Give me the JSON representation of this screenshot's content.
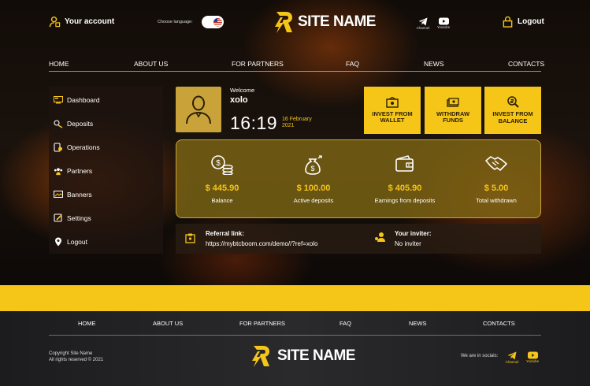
{
  "header": {
    "account_label": "Your account",
    "language_label": "Choose language:",
    "logo_text": "SITE NAME",
    "socials": [
      {
        "icon": "telegram-icon",
        "label": "Channel"
      },
      {
        "icon": "youtube-icon",
        "label": "Youtube"
      }
    ],
    "logout_label": "Logout"
  },
  "nav": [
    "HOME",
    "ABOUT US",
    "FOR PARTNERS",
    "FAQ",
    "NEWS",
    "CONTACTS"
  ],
  "sidebar": {
    "items": [
      {
        "label": "Dashboard",
        "icon": "dashboard-icon"
      },
      {
        "label": "Deposits",
        "icon": "deposits-icon"
      },
      {
        "label": "Operations",
        "icon": "operations-icon"
      },
      {
        "label": "Partners",
        "icon": "partners-icon"
      },
      {
        "label": "Banners",
        "icon": "banners-icon"
      },
      {
        "label": "Settings",
        "icon": "settings-icon"
      },
      {
        "label": "Logout",
        "icon": "logout-pin-icon"
      }
    ]
  },
  "welcome": {
    "label": "Welcome",
    "username": "xolo",
    "time": "16:19",
    "date_line1": "16 February",
    "date_line2": "2021"
  },
  "actions": [
    {
      "line1": "INVEST FROM",
      "line2": "WALLET",
      "icon": "wallet-invest-icon"
    },
    {
      "line1": "WITHDRAW",
      "line2": "FUNDS",
      "icon": "cash-icon"
    },
    {
      "line1": "INVEST FROM",
      "line2": "BALANCE",
      "icon": "balance-search-icon"
    }
  ],
  "stats": [
    {
      "value": "$ 445.90",
      "label": "Balance",
      "icon": "coins-icon"
    },
    {
      "value": "$ 100.00",
      "label": "Active deposits",
      "icon": "money-bag-icon"
    },
    {
      "value": "$ 405.90",
      "label": "Earnings from deposits",
      "icon": "wallet-icon"
    },
    {
      "value": "$ 5.00",
      "label": "Total withdrawn",
      "icon": "handshake-icon"
    }
  ],
  "referral": {
    "title": "Referral link:",
    "link": "https://mybtcboom.com/demo//?ref=xolo",
    "inviter_title": "Your inviter:",
    "inviter_value": "No inviter"
  },
  "footer": {
    "nav": [
      "HOME",
      "ABOUT US",
      "FOR PARTNERS",
      "FAQ",
      "NEWS",
      "CONTACTS"
    ],
    "copyright_line1": "Copyright Site Name",
    "copyright_line2": "All rights reserved © 2021",
    "logo_text": "SITE NAME",
    "socials_label": "We are in socials:",
    "socials": [
      {
        "icon": "telegram-icon",
        "label": "Channel"
      },
      {
        "icon": "youtube-icon",
        "label": "Youtube"
      }
    ]
  },
  "colors": {
    "accent": "#f5c518",
    "panel": "#826914",
    "footer": "#2a2a2c"
  }
}
